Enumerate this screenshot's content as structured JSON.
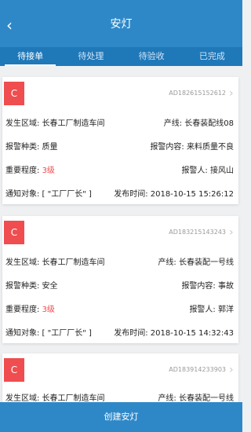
{
  "header": {
    "title": "安灯",
    "back_icon": "chevron-left"
  },
  "tabs": [
    {
      "label": "待接单",
      "active": true
    },
    {
      "label": "待处理",
      "active": false
    },
    {
      "label": "待验收",
      "active": false
    },
    {
      "label": "已完成",
      "active": false
    }
  ],
  "cards": [
    {
      "badge": "C",
      "code": "AD182615152612",
      "rows": [
        {
          "left": "发生区域: 长春工厂制造车间",
          "right": "产线: 长春装配线08"
        },
        {
          "left": "报警种类: 质量",
          "right": "报警内容: 来料质量不良"
        },
        {
          "left_label": "重要程度: ",
          "left_value": "3级",
          "right": "报警人: 接风山"
        },
        {
          "left": "通知对象: [ \"工厂厂长\" ]",
          "right": "发布时间: 2018-10-15 15:26:12"
        }
      ]
    },
    {
      "badge": "C",
      "code": "AD183215143243",
      "rows": [
        {
          "left": "发生区域: 长春工厂制造车间",
          "right": "产线: 长春装配一号线"
        },
        {
          "left": "报警种类: 安全",
          "right": "报警内容: 事故"
        },
        {
          "left_label": "重要程度: ",
          "left_value": "3级",
          "right": "报警人: 郭洋"
        },
        {
          "left": "通知对象: [ \"工厂厂长\" ]",
          "right": "发布时间: 2018-10-15 14:32:43"
        }
      ]
    },
    {
      "badge": "C",
      "code": "AD183914233903",
      "rows": [
        {
          "left": "发生区域: 长春工厂制造车间",
          "right": "产线: 长春装配一号线"
        }
      ]
    }
  ],
  "bottom_button": {
    "label": "创建安灯"
  },
  "colors": {
    "header_bg": "#2e88c8",
    "tabs_bg": "#1f78b8",
    "badge_red": "#ef4d4f"
  }
}
